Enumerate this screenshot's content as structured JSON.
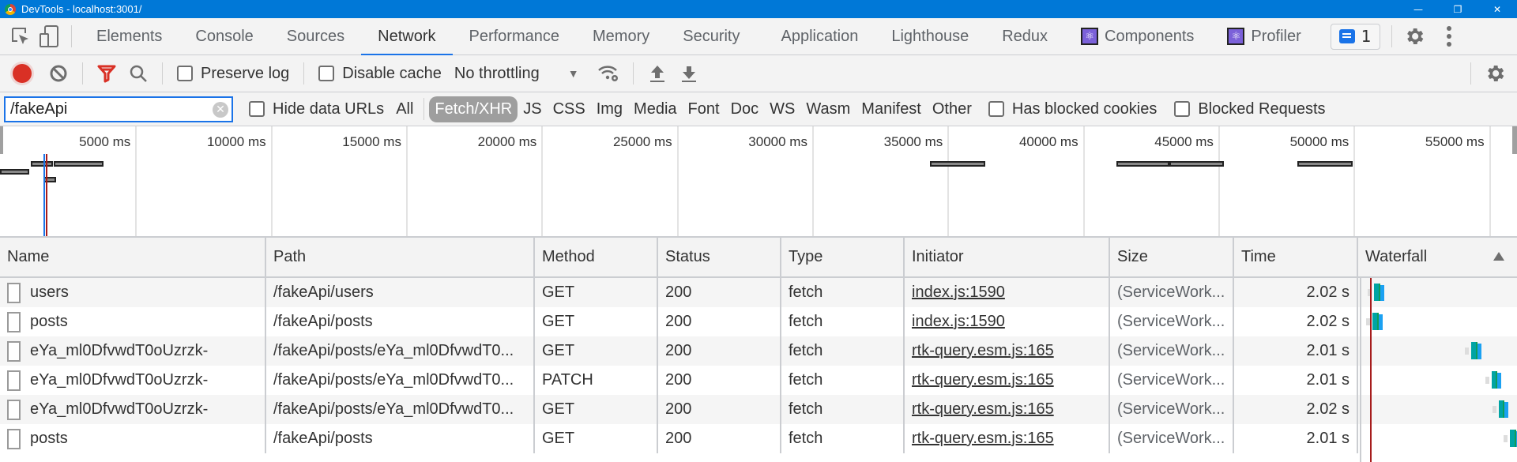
{
  "window": {
    "title": "DevTools - localhost:3001/",
    "controls": {
      "minimize": "—",
      "restore": "❐",
      "close": "✕"
    }
  },
  "tabbar": {
    "icons": [
      "inspect-element-icon",
      "device-toolbar-icon"
    ],
    "tabs": [
      {
        "label": "Elements",
        "active": false
      },
      {
        "label": "Console",
        "active": false
      },
      {
        "label": "Sources",
        "active": false
      },
      {
        "label": "Network",
        "active": true
      },
      {
        "label": "Performance",
        "active": false
      },
      {
        "label": "Memory",
        "active": false
      },
      {
        "label": "Security",
        "active": false
      },
      {
        "label": "Application",
        "active": false
      },
      {
        "label": "Lighthouse",
        "active": false
      },
      {
        "label": "Redux",
        "active": false
      },
      {
        "label": "Components",
        "active": false,
        "icon": "react-icon"
      },
      {
        "label": "Profiler",
        "active": false,
        "icon": "react-icon"
      }
    ],
    "issues_count": "1",
    "react_glyph": "⚛"
  },
  "toolbar": {
    "preserve_log": {
      "label": "Preserve log",
      "checked": false
    },
    "disable_cache": {
      "label": "Disable cache",
      "checked": false
    },
    "throttling": "No throttling",
    "dropdown_arrow": "▼"
  },
  "filterbar": {
    "filter_value": "/fakeApi",
    "clear_glyph": "✕",
    "hide_data_urls": {
      "label": "Hide data URLs",
      "checked": false
    },
    "types": [
      {
        "label": "All",
        "active": false
      },
      {
        "label": "Fetch/XHR",
        "active": true
      },
      {
        "label": "JS",
        "active": false
      },
      {
        "label": "CSS",
        "active": false
      },
      {
        "label": "Img",
        "active": false
      },
      {
        "label": "Media",
        "active": false
      },
      {
        "label": "Font",
        "active": false
      },
      {
        "label": "Doc",
        "active": false
      },
      {
        "label": "WS",
        "active": false
      },
      {
        "label": "Wasm",
        "active": false
      },
      {
        "label": "Manifest",
        "active": false
      },
      {
        "label": "Other",
        "active": false
      }
    ],
    "has_blocked_cookies": {
      "label": "Has blocked cookies",
      "checked": false
    },
    "blocked_requests": {
      "label": "Blocked Requests",
      "checked": false
    }
  },
  "overview": {
    "ticks": [
      "5000 ms",
      "10000 ms",
      "15000 ms",
      "20000 ms",
      "25000 ms",
      "30000 ms",
      "35000 ms",
      "40000 ms",
      "45000 ms",
      "50000 ms",
      "55000 ms"
    ],
    "tick_values_ms": [
      5000,
      10000,
      15000,
      20000,
      25000,
      30000,
      35000,
      40000,
      45000,
      50000,
      55000
    ],
    "range_ms": [
      0,
      55800
    ],
    "requests_ms": [
      {
        "start": 0,
        "end": 1080,
        "lane": 1
      },
      {
        "start": 1140,
        "end": 1970,
        "lane": 0
      },
      {
        "start": 1970,
        "end": 3810,
        "lane": 0
      },
      {
        "start": 1600,
        "end": 2070,
        "lane": 2
      },
      {
        "start": 34360,
        "end": 36390,
        "lane": 0
      },
      {
        "start": 41250,
        "end": 43180,
        "lane": 0
      },
      {
        "start": 43180,
        "end": 45220,
        "lane": 0
      },
      {
        "start": 47910,
        "end": 49950,
        "lane": 0
      }
    ],
    "dom_content_loaded_ms": 1600,
    "load_ms": 1700
  },
  "table": {
    "columns": [
      "Name",
      "Path",
      "Method",
      "Status",
      "Type",
      "Initiator",
      "Size",
      "Time",
      "Waterfall"
    ],
    "sort_indicator": "ascending",
    "rows": [
      {
        "name": "users",
        "path": "/fakeApi/users",
        "method": "GET",
        "status": "200",
        "type": "fetch",
        "initiator": "index.js:1590",
        "size": "(ServiceWork...",
        "time": "2.02 s",
        "wf_start": 0.045,
        "wf_dur": 0.07
      },
      {
        "name": "posts",
        "path": "/fakeApi/posts",
        "method": "GET",
        "status": "200",
        "type": "fetch",
        "initiator": "index.js:1590",
        "size": "(ServiceWork...",
        "time": "2.02 s",
        "wf_start": 0.035,
        "wf_dur": 0.07
      },
      {
        "name": "eYa_ml0DfvwdT0oUzrzk-",
        "path": "/fakeApi/posts/eYa_ml0DfvwdT0...",
        "method": "GET",
        "status": "200",
        "type": "fetch",
        "initiator": "rtk-query.esm.js:165",
        "size": "(ServiceWork...",
        "time": "2.01 s",
        "wf_start": 0.73,
        "wf_dur": 0.07
      },
      {
        "name": "eYa_ml0DfvwdT0oUzrzk-",
        "path": "/fakeApi/posts/eYa_ml0DfvwdT0...",
        "method": "PATCH",
        "status": "200",
        "type": "fetch",
        "initiator": "rtk-query.esm.js:165",
        "size": "(ServiceWork...",
        "time": "2.01 s",
        "wf_start": 0.87,
        "wf_dur": 0.07
      },
      {
        "name": "eYa_ml0DfvwdT0oUzrzk-",
        "path": "/fakeApi/posts/eYa_ml0DfvwdT0...",
        "method": "GET",
        "status": "200",
        "type": "fetch",
        "initiator": "rtk-query.esm.js:165",
        "size": "(ServiceWork...",
        "time": "2.02 s",
        "wf_start": 0.92,
        "wf_dur": 0.07
      },
      {
        "name": "posts",
        "path": "/fakeApi/posts",
        "method": "GET",
        "status": "200",
        "type": "fetch",
        "initiator": "rtk-query.esm.js:165",
        "size": "(ServiceWork...",
        "time": "2.01 s",
        "wf_start": 1.0,
        "wf_dur": 0.07
      }
    ]
  },
  "colors": {
    "accent": "#1a73e8",
    "record": "#d93025",
    "titlebar": "#0078d7",
    "waterfall_ttfb": "#00a4a4",
    "waterfall_download": "#1ba1f2",
    "load_line": "#a61c1c",
    "dcl_line": "#1a73e8"
  }
}
